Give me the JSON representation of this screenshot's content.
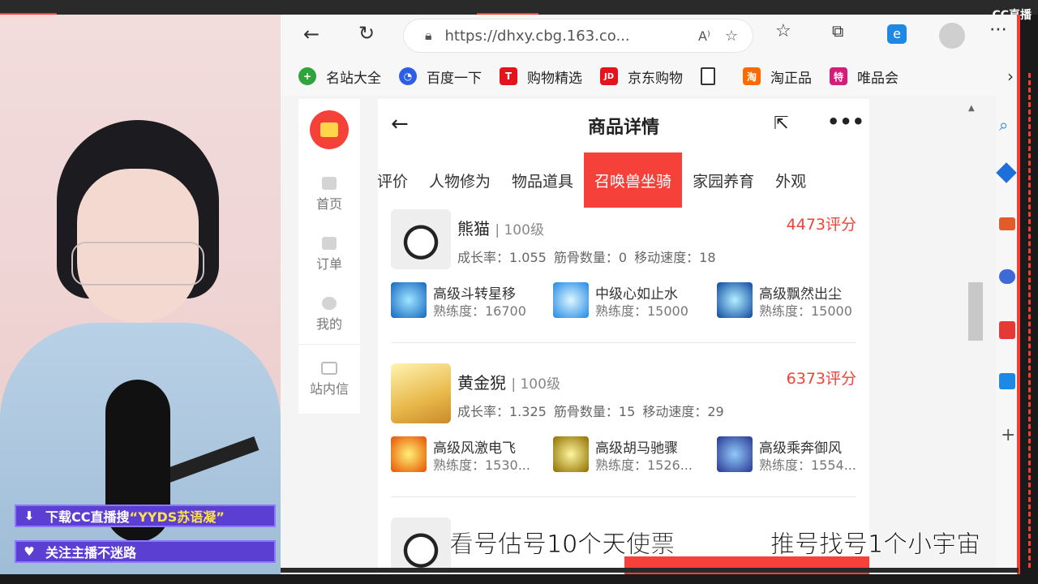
{
  "overlay": {
    "cc_logo": "CC直播",
    "banner1_prefix": "下载CC直播搜",
    "banner1_highlight": "“YYDS苏语凝”",
    "banner2": "关注主播不迷路",
    "subtitle_left": "看号估号10个天使票",
    "subtitle_right": "推号找号1个小宇宙"
  },
  "browser": {
    "url": "https://dhxy.cbg.163.co...",
    "bookmarks": [
      {
        "label": "名站大全",
        "icon": "plus-circle-icon",
        "color": "#2ea43a"
      },
      {
        "label": "百度一下",
        "icon": "baidu-paw-icon",
        "color": "#2d5ee8"
      },
      {
        "label": "购物精选",
        "icon": "t-icon",
        "color": "#e3141c"
      },
      {
        "label": "京东购物",
        "icon": "jd-icon",
        "color": "#e3141c"
      },
      {
        "label": "",
        "icon": "page-icon",
        "color": "#ffffff"
      },
      {
        "label": "淘正品",
        "icon": "tao-icon",
        "color": "#ff6a00"
      },
      {
        "label": "唯品会",
        "icon": "te-icon",
        "color": "#d51c7a"
      }
    ],
    "bookmark_icon_text": {
      "t": "T",
      "jd": "JD",
      "tao": "淘",
      "te": "特"
    }
  },
  "sidenav": {
    "items": [
      "首页",
      "订单",
      "我的",
      "站内信"
    ]
  },
  "page": {
    "title": "商品详情",
    "tabs": [
      "评价",
      "人物修为",
      "物品道具",
      "召唤兽坐骑",
      "家园养育",
      "外观"
    ],
    "active_tab": "召唤兽坐骑",
    "pets": [
      {
        "name": "熊猫",
        "level": "| 100级",
        "score": "4473评分",
        "stats": "成长率：1.055   筋骨数量：0   移动速度：18",
        "skills": [
          {
            "name": "高级斗转星移",
            "exp": "熟练度：16700"
          },
          {
            "name": "中级心如止水",
            "exp": "熟练度：15000"
          },
          {
            "name": "高级飘然出尘",
            "exp": "熟练度：15000"
          }
        ]
      },
      {
        "name": "黄金猊",
        "level": "| 100级",
        "score": "6373评分",
        "stats": "成长率：1.325   筋骨数量：15   移动速度：29",
        "skills": [
          {
            "name": "高级风激电飞",
            "exp": "熟练度：1530..."
          },
          {
            "name": "高级胡马驰骤",
            "exp": "熟练度：1526..."
          },
          {
            "name": "高级乘奔御风",
            "exp": "熟练度：1554..."
          }
        ]
      }
    ]
  },
  "colors": {
    "accent": "#f5413a",
    "banner": "#5b3fd3"
  }
}
